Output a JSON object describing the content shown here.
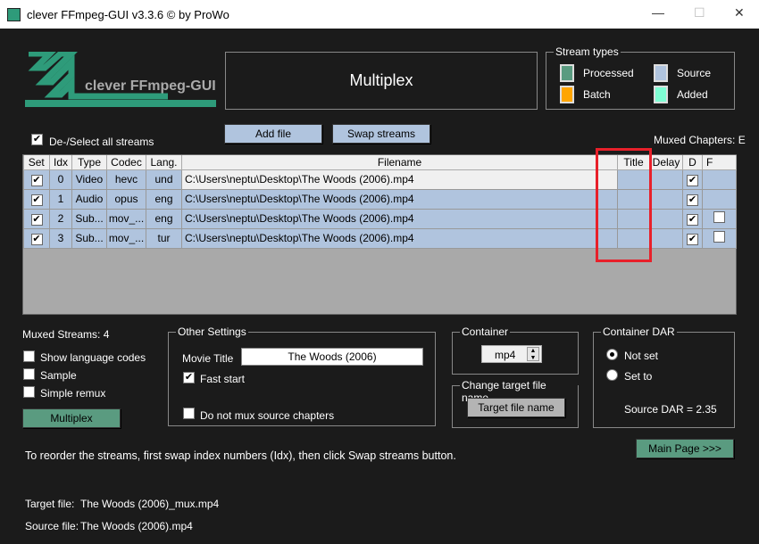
{
  "window": {
    "title": "clever FFmpeg-GUI v3.3.6   © by ProWo",
    "minimize": "—",
    "maximize": "☐",
    "close": "✕"
  },
  "logo": {
    "text": "clever FFmpeg-GUI"
  },
  "header": {
    "title": "Multiplex"
  },
  "stream_types": {
    "legend": "Stream types",
    "items": [
      {
        "label": "Processed",
        "color": "#5a9b80"
      },
      {
        "label": "Source",
        "color": "#b0c4de"
      },
      {
        "label": "Batch",
        "color": "#ffa500"
      },
      {
        "label": "Added",
        "color": "#7fffd4"
      }
    ]
  },
  "toolbar": {
    "add_file": "Add file",
    "swap_streams": "Swap streams"
  },
  "select_all": {
    "label": "De-/Select all streams",
    "checked": true
  },
  "muxed_chapters": "Muxed Chapters: E",
  "table": {
    "columns": [
      "Set",
      "Idx",
      "Type",
      "Codec",
      "Lang.",
      "Filename",
      "",
      "Title",
      "Delay",
      "D",
      "F"
    ],
    "rows": [
      {
        "set": true,
        "idx": "0",
        "type": "Video",
        "codec": "hevc",
        "lang": "und",
        "filename": "C:\\Users\\neptu\\Desktop\\The Woods (2006).mp4",
        "title": "",
        "delay": "",
        "d": true,
        "f": null
      },
      {
        "set": true,
        "idx": "1",
        "type": "Audio",
        "codec": "opus",
        "lang": "eng",
        "filename": "C:\\Users\\neptu\\Desktop\\The Woods (2006).mp4",
        "title": "",
        "delay": "",
        "d": true,
        "f": null
      },
      {
        "set": true,
        "idx": "2",
        "type": "Sub...",
        "codec": "mov_...",
        "lang": "eng",
        "filename": "C:\\Users\\neptu\\Desktop\\The Woods (2006).mp4",
        "title": "",
        "delay": "",
        "d": true,
        "f": false
      },
      {
        "set": true,
        "idx": "3",
        "type": "Sub...",
        "codec": "mov_...",
        "lang": "tur",
        "filename": "C:\\Users\\neptu\\Desktop\\The Woods (2006).mp4",
        "title": "",
        "delay": "",
        "d": true,
        "f": false
      }
    ]
  },
  "highlight_color": "#e8202a",
  "left": {
    "muxed_streams": "Muxed Streams:  4",
    "show_lang": "Show language codes",
    "sample": "Sample",
    "simple_remux": "Simple remux",
    "multiplex_btn": "Multiplex"
  },
  "other": {
    "legend": "Other Settings",
    "movie_title_label": "Movie Title",
    "movie_title": "The Woods (2006)",
    "fast_start": "Fast start",
    "no_chapters": "Do not mux source chapters"
  },
  "container": {
    "legend": "Container",
    "value": "mp4"
  },
  "target": {
    "legend": "Change target file name",
    "button": "Target file name"
  },
  "dar": {
    "legend": "Container DAR",
    "not_set": "Not set",
    "set_to": "Set to",
    "source": "Source DAR = 2.35"
  },
  "main_page": "Main Page >>>",
  "hint": "To reorder the streams, first swap index numbers (Idx), then click Swap streams button.",
  "target_file": {
    "label": "Target file:",
    "value": "The Woods (2006)_mux.mp4"
  },
  "source_file": {
    "label": "Source file:",
    "value": "The Woods (2006).mp4"
  }
}
